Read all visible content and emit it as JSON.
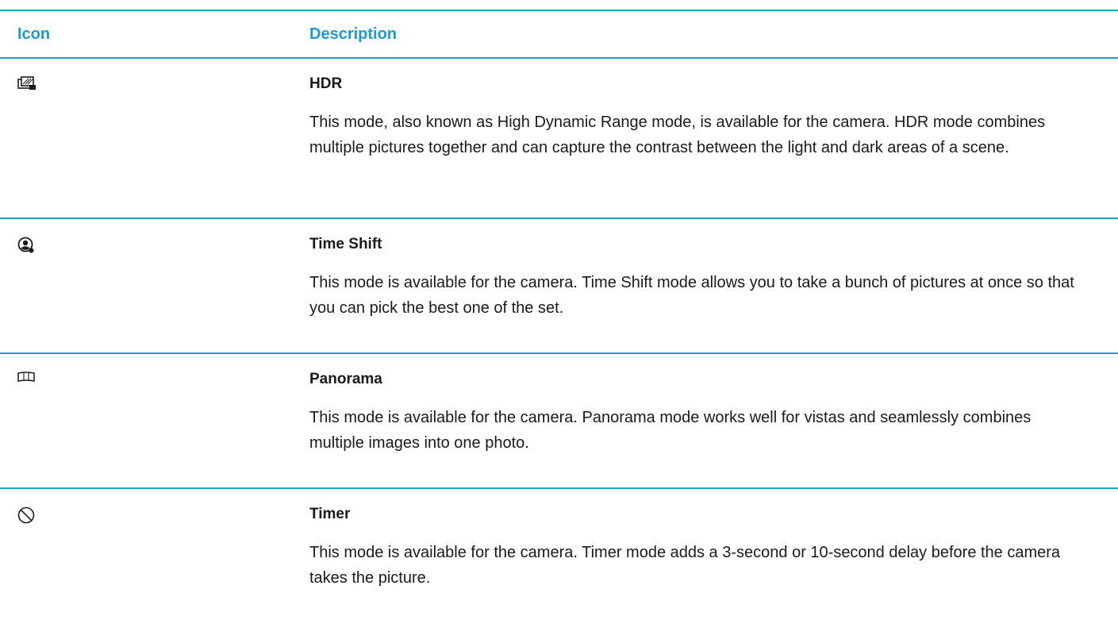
{
  "table": {
    "header": {
      "icon_label": "Icon",
      "description_label": "Description"
    },
    "rows": [
      {
        "icon": "hdr-icon",
        "title": "HDR",
        "description": "This mode, also known as High Dynamic Range mode, is available for the camera. HDR mode combines multiple pictures together and can capture the contrast between the light and dark areas of a scene."
      },
      {
        "icon": "time-shift-icon",
        "title": "Time Shift",
        "description": "This mode is available for the camera. Time Shift mode allows you to take a bunch of pictures at once so that you can pick the best one of the set."
      },
      {
        "icon": "panorama-icon",
        "title": "Panorama",
        "description": "This mode is available for the camera. Panorama mode works well for vistas and seamlessly combines multiple images into one photo."
      },
      {
        "icon": "timer-icon",
        "title": "Timer",
        "description": "This mode is available for the camera. Timer mode adds a 3-second or 10-second delay before the camera takes the picture."
      }
    ]
  },
  "colors": {
    "accent": "#1a9bd7",
    "rule": "#1aa0c8",
    "text": "#1a1a1a"
  }
}
